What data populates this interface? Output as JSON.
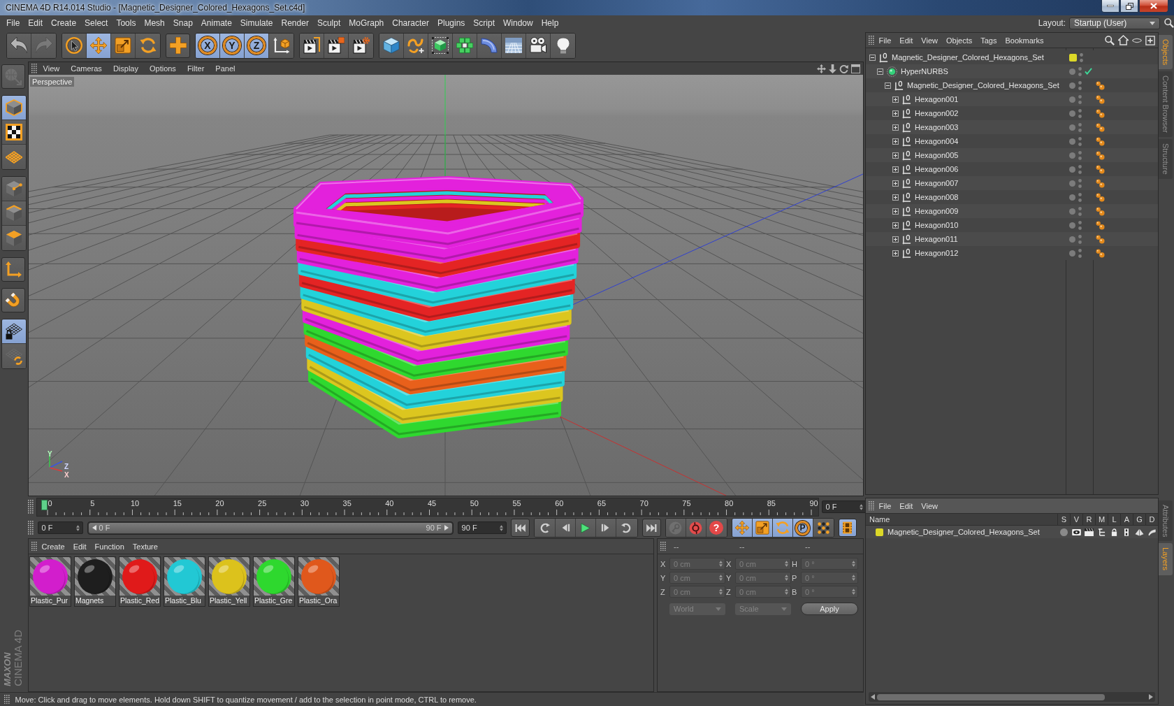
{
  "window": {
    "title": "CINEMA 4D R14.014 Studio - [Magnetic_Designer_Colored_Hexagons_Set.c4d]"
  },
  "menu_bar": {
    "items": [
      "File",
      "Edit",
      "Create",
      "Select",
      "Tools",
      "Mesh",
      "Snap",
      "Animate",
      "Simulate",
      "Render",
      "Sculpt",
      "MoGraph",
      "Character",
      "Plugins",
      "Script",
      "Window",
      "Help"
    ],
    "layout_label": "Layout:",
    "layout_value": "Startup (User)"
  },
  "toolbar": {
    "groups": [
      [
        {
          "selected": false,
          "disabled": false
        },
        {
          "selected": false,
          "disabled": true
        }
      ],
      [
        {
          "selected": false
        },
        {
          "selected": true
        },
        {
          "selected": false
        },
        {
          "selected": false
        }
      ],
      [
        {
          "selected": false
        }
      ],
      [
        {
          "label": "X",
          "selected": true
        },
        {
          "label": "Y",
          "selected": true
        },
        {
          "label": "Z",
          "selected": true
        },
        {
          "selected": false
        }
      ],
      [
        {
          "selected": false
        },
        {
          "selected": false
        },
        {
          "selected": false
        }
      ],
      [
        {
          "selected": false
        },
        {
          "selected": false
        },
        {
          "selected": false
        },
        {
          "selected": false
        },
        {
          "selected": false
        },
        {
          "selected": false
        },
        {
          "selected": false
        },
        {
          "selected": false
        }
      ]
    ]
  },
  "left_toolbar": {
    "groups": [
      [
        {
          "selected": false,
          "disabled": true
        }
      ],
      [
        {
          "selected": true
        },
        {
          "selected": false
        },
        {
          "selected": false
        }
      ],
      [
        {
          "selected": false
        },
        {
          "selected": false
        },
        {
          "selected": false
        }
      ],
      [
        {
          "selected": false
        }
      ],
      [
        {
          "selected": false
        }
      ],
      [
        {
          "selected": true
        },
        {
          "selected": false
        }
      ]
    ]
  },
  "logo": {
    "brand": "MAXON",
    "product": "CINEMA 4D"
  },
  "viewport": {
    "menu": [
      "View",
      "Cameras",
      "Display",
      "Options",
      "Filter",
      "Panel"
    ],
    "camera_label": "Perspective",
    "gizmo_labels": [
      "Y",
      "Z",
      "X"
    ]
  },
  "timeline": {
    "ticks": [
      "0",
      "5",
      "10",
      "15",
      "20",
      "25",
      "30",
      "35",
      "40",
      "45",
      "50",
      "55",
      "60",
      "65",
      "70",
      "75",
      "80",
      "85",
      "90"
    ],
    "level": 0,
    "current_frame": "0 F",
    "start_field": "0 F",
    "range": {
      "start": "0 F",
      "end": "90 F",
      "level": 1
    },
    "end_field": "90 F",
    "record_buttons": [
      {
        "disabled": true
      },
      {
        "disabled": false
      },
      {
        "label": "?",
        "disabled": false
      }
    ],
    "transform_buttons": [
      {
        "selected": true
      },
      {
        "selected": true
      },
      {
        "selected": true
      },
      {
        "label": "P",
        "selected": true
      },
      {
        "selected": false
      }
    ],
    "film_button": {
      "selected": true
    }
  },
  "materials": {
    "menu": [
      "Create",
      "Edit",
      "Function",
      "Texture"
    ],
    "items": [
      {
        "name": "Plastic_Pur",
        "color": "#d21ecc"
      },
      {
        "name": "Magnets",
        "color": "#1e1e1e"
      },
      {
        "name": "Plastic_Red",
        "color": "#e01a1a"
      },
      {
        "name": "Plastic_Blu",
        "color": "#22c8d4"
      },
      {
        "name": "Plastic_Yell",
        "color": "#dcc21c"
      },
      {
        "name": "Plastic_Gre",
        "color": "#2ed82e"
      },
      {
        "name": "Plastic_Ora",
        "color": "#e0581c"
      }
    ]
  },
  "coordinates": {
    "headers": [
      "--",
      "--",
      "--"
    ],
    "rows": [
      [
        {
          "axis": "X",
          "value": "0 cm"
        },
        {
          "axis": "X",
          "value": "0 cm"
        },
        {
          "axis": "H",
          "value": "0 °"
        }
      ],
      [
        {
          "axis": "Y",
          "value": "0 cm"
        },
        {
          "axis": "Y",
          "value": "0 cm"
        },
        {
          "axis": "P",
          "value": "0 °"
        }
      ],
      [
        {
          "axis": "Z",
          "value": "0 cm"
        },
        {
          "axis": "Z",
          "value": "0 cm"
        },
        {
          "axis": "B",
          "value": "0 °"
        }
      ]
    ],
    "dropdowns": [
      "World",
      "Scale"
    ],
    "apply": "Apply"
  },
  "status_bar": {
    "text": "Move: Click and drag to move elements. Hold down SHIFT to quantize movement / add to the selection in point mode, CTRL to remove."
  },
  "object_manager": {
    "menu": [
      "File",
      "Edit",
      "View",
      "Objects",
      "Tags",
      "Bookmarks"
    ],
    "objects": [
      {
        "name": "Magnetic_Designer_Colored_Hexagons_Set",
        "kind": "null",
        "expanded": true,
        "color": "#dcd828",
        "children": [
          {
            "name": "HyperNURBS",
            "kind": "nurbs",
            "expanded": true,
            "enabled": true,
            "children": [
              {
                "name": "Magnetic_Designer_Colored_Hexagons_Set",
                "kind": "null",
                "expanded": true,
                "tags": [
                  {
                    "kind": "material"
                  }
                ],
                "children": [
                  {
                    "name": "Hexagon001",
                    "kind": "null",
                    "expanded": false,
                    "tags": [
                      {
                        "kind": "material"
                      }
                    ]
                  },
                  {
                    "name": "Hexagon002",
                    "kind": "null",
                    "expanded": false,
                    "tags": [
                      {
                        "kind": "material"
                      }
                    ]
                  },
                  {
                    "name": "Hexagon003",
                    "kind": "null",
                    "expanded": false,
                    "tags": [
                      {
                        "kind": "material"
                      }
                    ]
                  },
                  {
                    "name": "Hexagon004",
                    "kind": "null",
                    "expanded": false,
                    "tags": [
                      {
                        "kind": "material"
                      }
                    ]
                  },
                  {
                    "name": "Hexagon005",
                    "kind": "null",
                    "expanded": false,
                    "tags": [
                      {
                        "kind": "material"
                      }
                    ]
                  },
                  {
                    "name": "Hexagon006",
                    "kind": "null",
                    "expanded": false,
                    "tags": [
                      {
                        "kind": "material"
                      }
                    ]
                  },
                  {
                    "name": "Hexagon007",
                    "kind": "null",
                    "expanded": false,
                    "tags": [
                      {
                        "kind": "material"
                      }
                    ]
                  },
                  {
                    "name": "Hexagon008",
                    "kind": "null",
                    "expanded": false,
                    "tags": [
                      {
                        "kind": "material"
                      }
                    ]
                  },
                  {
                    "name": "Hexagon009",
                    "kind": "null",
                    "expanded": false,
                    "tags": [
                      {
                        "kind": "material"
                      }
                    ]
                  },
                  {
                    "name": "Hexagon010",
                    "kind": "null",
                    "expanded": false,
                    "tags": [
                      {
                        "kind": "material"
                      }
                    ]
                  },
                  {
                    "name": "Hexagon011",
                    "kind": "null",
                    "expanded": false,
                    "tags": [
                      {
                        "kind": "material"
                      }
                    ]
                  },
                  {
                    "name": "Hexagon012",
                    "kind": "null",
                    "expanded": false,
                    "tags": [
                      {
                        "kind": "material"
                      }
                    ]
                  }
                ]
              }
            ]
          }
        ]
      }
    ]
  },
  "layer_manager": {
    "menu": [
      "File",
      "Edit",
      "View"
    ],
    "columns": [
      "Name",
      "S",
      "V",
      "R",
      "M",
      "L",
      "A",
      "G",
      "D"
    ],
    "layers": [
      {
        "name": "Magnetic_Designer_Colored_Hexagons_Set",
        "color": "#dcd828"
      }
    ]
  },
  "side_tabs": {
    "top": [
      {
        "label": "Objects",
        "selected": true
      },
      {
        "label": "Content Browser",
        "selected": false
      },
      {
        "label": "Structure",
        "selected": false
      }
    ],
    "bottom": [
      {
        "label": "Attributes",
        "selected": false
      },
      {
        "label": "Layers",
        "selected": true
      }
    ]
  }
}
